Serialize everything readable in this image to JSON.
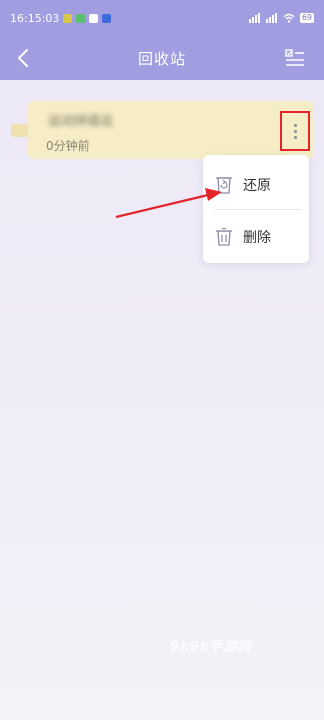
{
  "status_bar": {
    "time": "16:15:03",
    "battery": "69"
  },
  "app_bar": {
    "title": "回收站",
    "back_icon": "chevron-left-icon",
    "menu_icon": "list-check-icon"
  },
  "note": {
    "title": "运动拼插运",
    "time": "0分钟前"
  },
  "context_menu": {
    "items": [
      {
        "label": "还原",
        "icon": "restore-icon"
      },
      {
        "label": "删除",
        "icon": "trash-icon"
      }
    ]
  },
  "watermark": "9k9k手游网",
  "colors": {
    "header": "#a09ee0",
    "card": "#f6ecc6",
    "highlight": "#e3242b",
    "menu_icon": "#8e8aa8"
  }
}
